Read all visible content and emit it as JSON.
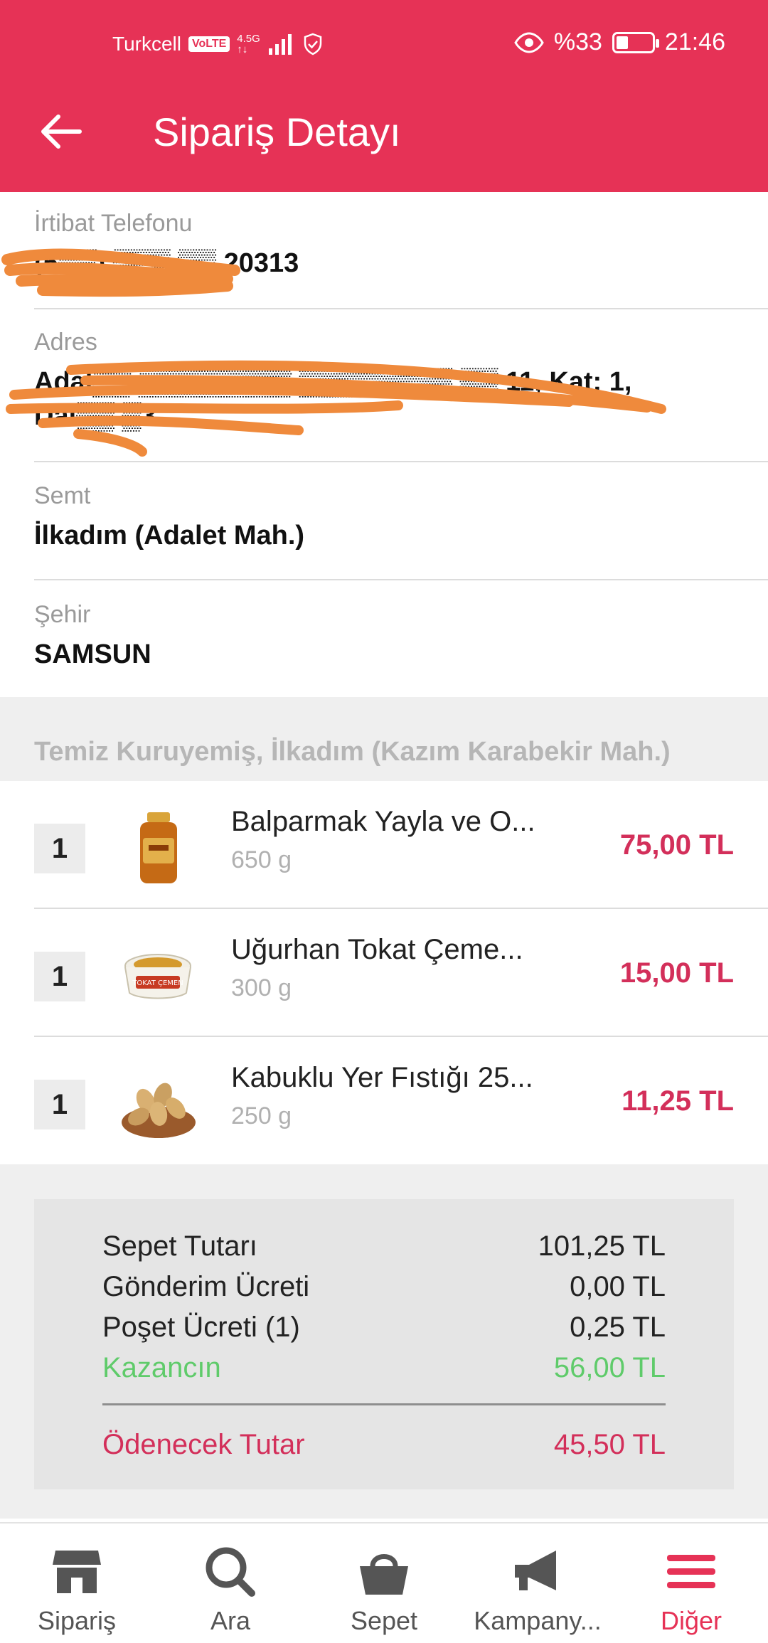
{
  "status_bar": {
    "carrier": "Turkcell",
    "volte": "VoLTE",
    "network_top": "4.5G",
    "network_bottom": "↑↓",
    "battery": "%33",
    "battery_level": 0.33,
    "time": "21:46"
  },
  "header": {
    "title": "Sipariş Detayı"
  },
  "contact": {
    "phone_label": "İrtibat Telefonu",
    "phone_value": "(5▒▒) ▒▒▒ ▒▒ 20313",
    "address_label": "Adres",
    "address_value": "Adal▒▒ ▒▒▒▒▒▒▒▒ ▒▒▒▒▒▒▒▒ ▒▒ 11, Kat: 1, Dai▒▒ ▒3",
    "district_label": "Semt",
    "district_value": "İlkadım (Adalet Mah.)",
    "city_label": "Şehir",
    "city_value": "SAMSUN"
  },
  "store": {
    "name": "Temiz Kuruyemiş, İlkadım (Kazım Karabekir Mah.)"
  },
  "items": [
    {
      "qty": "1",
      "name": "Balparmak Yayla ve O...",
      "weight": "650 g",
      "price": "75,00 TL",
      "icon": "honey-jar-icon"
    },
    {
      "qty": "1",
      "name": "Uğurhan Tokat Çeme...",
      "weight": "300 g",
      "price": "15,00 TL",
      "icon": "cemen-tub-icon"
    },
    {
      "qty": "1",
      "name": "Kabuklu Yer Fıstığı 25...",
      "weight": "250 g",
      "price": "11,25 TL",
      "icon": "peanut-bowl-icon"
    }
  ],
  "summary": {
    "basket_label": "Sepet Tutarı",
    "basket_value": "101,25 TL",
    "shipping_label": "Gönderim Ücreti",
    "shipping_value": "0,00 TL",
    "bag_label": "Poşet Ücreti (1)",
    "bag_value": "0,25 TL",
    "savings_label": "Kazancın",
    "savings_value": "56,00 TL",
    "total_label": "Ödenecek Tutar",
    "total_value": "45,50 TL"
  },
  "nav": [
    {
      "label": "Sipariş",
      "icon": "store-icon"
    },
    {
      "label": "Ara",
      "icon": "search-icon"
    },
    {
      "label": "Sepet",
      "icon": "basket-icon"
    },
    {
      "label": "Kampany...",
      "icon": "megaphone-icon"
    },
    {
      "label": "Diğer",
      "icon": "menu-icon"
    }
  ],
  "colors": {
    "brand": "#e63256",
    "price": "#d32f5a",
    "savings": "#5fcb6a",
    "redaction": "#ef8a3c"
  }
}
